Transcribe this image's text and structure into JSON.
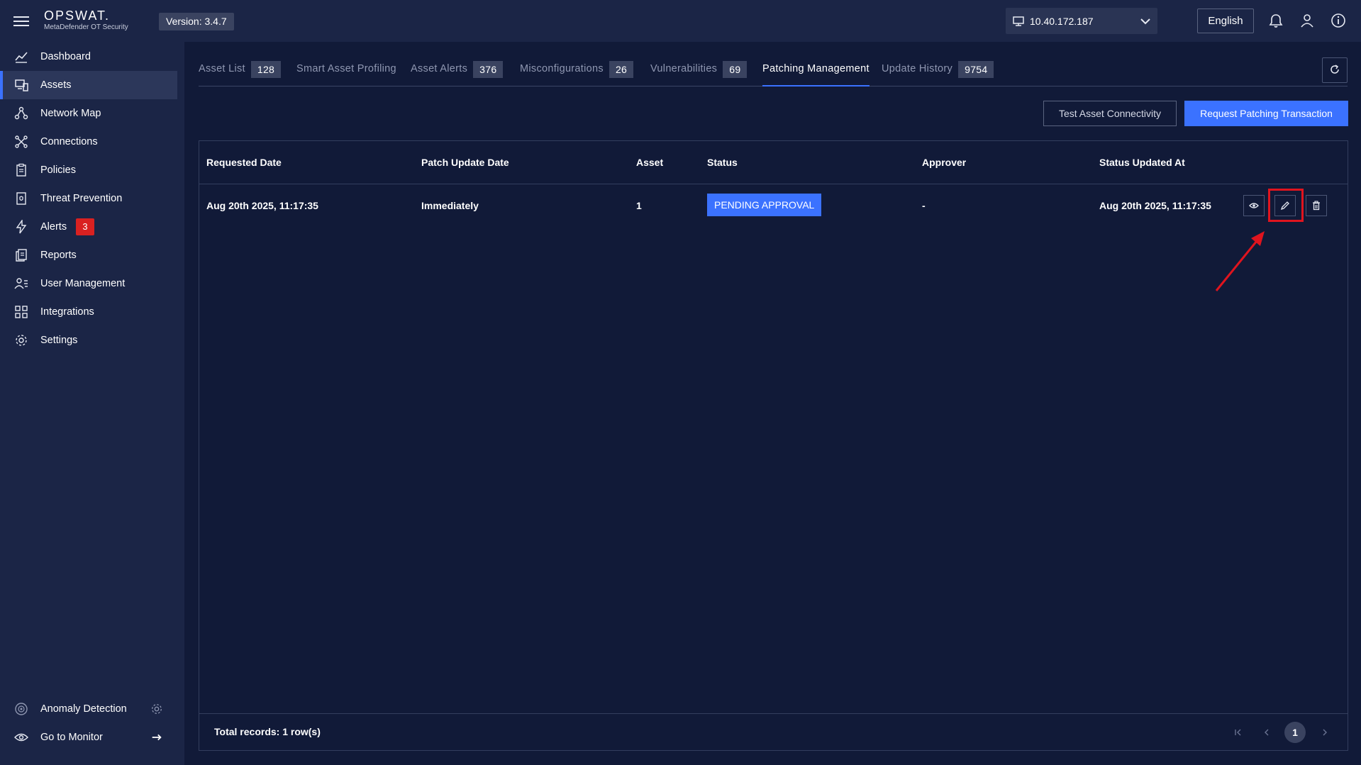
{
  "header": {
    "brand_name": "OPSWAT.",
    "brand_sub": "MetaDefender OT Security",
    "version": "Version: 3.4.7",
    "ip": "10.40.172.187",
    "language": "English"
  },
  "sidebar": {
    "items": [
      {
        "label": "Dashboard",
        "icon": "chart-line-icon"
      },
      {
        "label": "Assets",
        "icon": "assets-icon",
        "active": true
      },
      {
        "label": "Network Map",
        "icon": "network-icon"
      },
      {
        "label": "Connections",
        "icon": "connections-icon"
      },
      {
        "label": "Policies",
        "icon": "clipboard-icon"
      },
      {
        "label": "Threat Prevention",
        "icon": "document-shield-icon"
      },
      {
        "label": "Alerts",
        "icon": "lightning-icon",
        "badge": "3"
      },
      {
        "label": "Reports",
        "icon": "reports-icon"
      },
      {
        "label": "User Management",
        "icon": "users-icon"
      },
      {
        "label": "Integrations",
        "icon": "integrations-icon"
      },
      {
        "label": "Settings",
        "icon": "gear-icon"
      }
    ],
    "bottom": [
      {
        "label": "Anomaly Detection",
        "icon": "radar-icon"
      },
      {
        "label": "Go to Monitor",
        "icon": "eye-icon"
      }
    ]
  },
  "tabs": [
    {
      "label": "Asset List",
      "count": "128"
    },
    {
      "label": "Smart Asset Profiling",
      "count": ""
    },
    {
      "label": "Asset Alerts",
      "count": "376"
    },
    {
      "label": "Misconfigurations",
      "count": "26"
    },
    {
      "label": "Vulnerabilities",
      "count": "69"
    },
    {
      "label": "Patching Management",
      "count": "",
      "active": true
    },
    {
      "label": "Update History",
      "count": "9754"
    }
  ],
  "actions": {
    "test_connectivity": "Test Asset Connectivity",
    "request_patching": "Request Patching Transaction"
  },
  "table": {
    "columns": [
      "Requested Date",
      "Patch Update Date",
      "Asset",
      "Status",
      "Approver",
      "Status Updated At"
    ],
    "rows": [
      {
        "requested_date": "Aug 20th 2025, 11:17:35",
        "patch_update_date": "Immediately",
        "asset": "1",
        "status": "PENDING APPROVAL",
        "approver": "-",
        "status_updated_at": "Aug 20th 2025, 11:17:35"
      }
    ],
    "total": "Total records: 1 row(s)",
    "current_page": "1"
  },
  "colors": {
    "background": "#111a38",
    "panel": "#1b2546",
    "accent": "#3b72ff",
    "alert": "#d92121",
    "highlight": "#e0141e"
  }
}
